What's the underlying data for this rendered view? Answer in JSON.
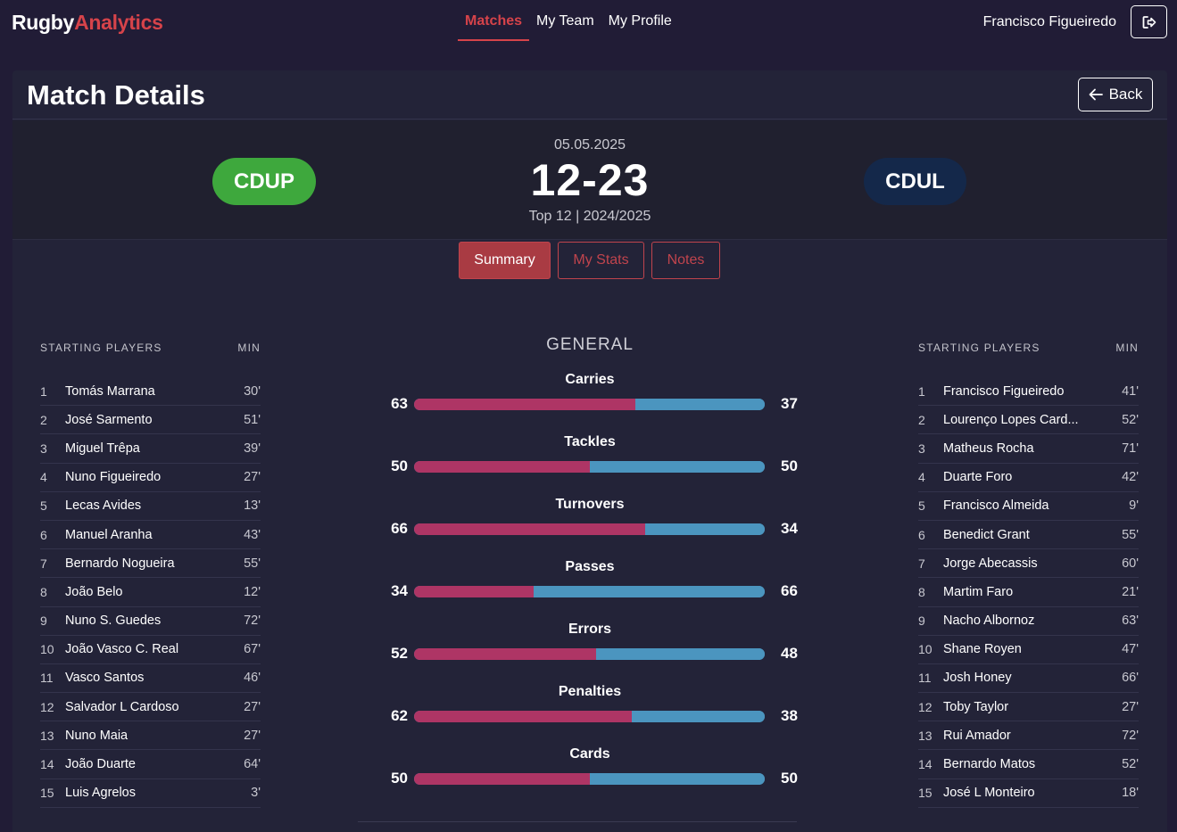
{
  "brand": {
    "part1": "Rugby",
    "part2": "Analytics"
  },
  "nav": {
    "links": [
      {
        "label": "Matches"
      },
      {
        "label": "My Team"
      },
      {
        "label": "My Profile"
      }
    ]
  },
  "user": {
    "name": "Francisco Figueiredo"
  },
  "icons": {
    "logout": "logout-icon",
    "back": "arrow-left-icon"
  },
  "page": {
    "title": "Match Details",
    "back_label": "Back"
  },
  "match": {
    "date": "05.05.2025",
    "score": "12-23",
    "competition": "Top 12 | 2024/2025",
    "home_team": "CDUP",
    "away_team": "CDUL"
  },
  "colors": {
    "accent": "#d6434a",
    "home": "#3ea83d",
    "away": "#14284a",
    "bar_home": "#ae3565",
    "bar_away": "#4b95bf"
  },
  "tabs": [
    {
      "label": "Summary",
      "active": true
    },
    {
      "label": "My Stats"
    },
    {
      "label": "Notes"
    }
  ],
  "home_roster": {
    "header_players": "STARTING PLAYERS",
    "header_min": "MIN",
    "players": [
      {
        "num": "1",
        "name": "Tomás Marrana",
        "min": "30'"
      },
      {
        "num": "2",
        "name": "José Sarmento",
        "min": "51'"
      },
      {
        "num": "3",
        "name": "Miguel Trêpa",
        "min": "39'"
      },
      {
        "num": "4",
        "name": "Nuno Figueiredo",
        "min": "27'"
      },
      {
        "num": "5",
        "name": "Lecas Avides",
        "min": "13'"
      },
      {
        "num": "6",
        "name": "Manuel Aranha",
        "min": "43'"
      },
      {
        "num": "7",
        "name": "Bernardo Nogueira",
        "min": "55'"
      },
      {
        "num": "8",
        "name": "João Belo",
        "min": "12'"
      },
      {
        "num": "9",
        "name": "Nuno S. Guedes",
        "min": "72'"
      },
      {
        "num": "10",
        "name": "João Vasco C. Real",
        "min": "67'"
      },
      {
        "num": "11",
        "name": "Vasco Santos",
        "min": "46'"
      },
      {
        "num": "12",
        "name": "Salvador L Cardoso",
        "min": "27'"
      },
      {
        "num": "13",
        "name": "Nuno Maia",
        "min": "27'"
      },
      {
        "num": "14",
        "name": "João Duarte",
        "min": "64'"
      },
      {
        "num": "15",
        "name": "Luis Agrelos",
        "min": "3'"
      }
    ]
  },
  "away_roster": {
    "header_players": "STARTING PLAYERS",
    "header_min": "MIN",
    "players": [
      {
        "num": "1",
        "name": "Francisco Figueiredo",
        "min": "41'"
      },
      {
        "num": "2",
        "name": "Lourenço Lopes Card...",
        "min": "52'"
      },
      {
        "num": "3",
        "name": "Matheus Rocha",
        "min": "71'"
      },
      {
        "num": "4",
        "name": "Duarte Foro",
        "min": "42'"
      },
      {
        "num": "5",
        "name": "Francisco Almeida",
        "min": "9'"
      },
      {
        "num": "6",
        "name": "Benedict Grant",
        "min": "55'"
      },
      {
        "num": "7",
        "name": "Jorge Abecassis",
        "min": "60'"
      },
      {
        "num": "8",
        "name": "Martim Faro",
        "min": "21'"
      },
      {
        "num": "9",
        "name": "Nacho Albornoz",
        "min": "63'"
      },
      {
        "num": "10",
        "name": "Shane Royen",
        "min": "47'"
      },
      {
        "num": "11",
        "name": "Josh Honey",
        "min": "66'"
      },
      {
        "num": "12",
        "name": "Toby Taylor",
        "min": "27'"
      },
      {
        "num": "13",
        "name": "Rui Amador",
        "min": "72'"
      },
      {
        "num": "14",
        "name": "Bernardo Matos",
        "min": "52'"
      },
      {
        "num": "15",
        "name": "José L Monteiro",
        "min": "18'"
      }
    ]
  },
  "general": {
    "title": "GENERAL",
    "stats": [
      {
        "label": "Carries",
        "home": 63,
        "away": 37
      },
      {
        "label": "Tackles",
        "home": 50,
        "away": 50
      },
      {
        "label": "Turnovers",
        "home": 66,
        "away": 34
      },
      {
        "label": "Passes",
        "home": 34,
        "away": 66
      },
      {
        "label": "Errors",
        "home": 52,
        "away": 48
      },
      {
        "label": "Penalties",
        "home": 62,
        "away": 38
      },
      {
        "label": "Cards",
        "home": 50,
        "away": 50
      }
    ]
  }
}
